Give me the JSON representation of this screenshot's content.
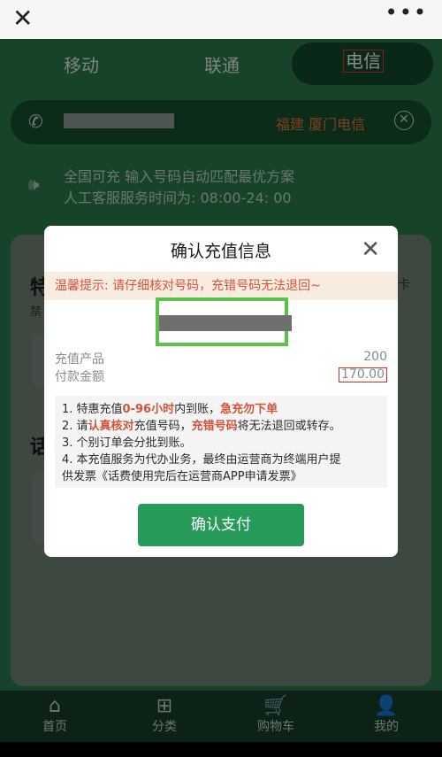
{
  "tabs": [
    {
      "label": "移动"
    },
    {
      "label": "联通"
    },
    {
      "label": "电信"
    }
  ],
  "phone_row": {
    "region": "福建 厦门电信"
  },
  "notice": {
    "line1": "全国可充 输入号码自动匹配最优方案",
    "line2": "人工客服服务时间为: 08:00-24: 00"
  },
  "background_card": {
    "title1": "特",
    "subtitle1": "禁",
    "title2": "话",
    "corner": "卡"
  },
  "modal": {
    "title": "确认充值信息",
    "warning": "温馨提示: 请仔细核对号码，充错号码无法退回~",
    "product_label": "充值产品",
    "product_value": "200",
    "amount_label": "付款金额",
    "amount_value": "170.00",
    "rules": {
      "r1a": "1. 特惠充值",
      "r1b": "0-96小时",
      "r1c": "内到账，",
      "r1d": "急充勿下单",
      "r2a": "2. 请",
      "r2b": "认真核对",
      "r2c": "充值号码，",
      "r2d": "充错号码",
      "r2e": "将无法退回或转存。",
      "r3": "3. 个别订单会分批到账。",
      "r4a": "4. 本充值服务为代办业务，最终由运营商为终端用户提",
      "r4b": "供发票《话费使用完后在运营商APP申请发票》"
    },
    "confirm_label": "确认支付"
  },
  "nav": [
    {
      "label": "首页",
      "icon": "home-icon"
    },
    {
      "label": "分类",
      "icon": "grid-icon"
    },
    {
      "label": "购物车",
      "icon": "cart-icon"
    },
    {
      "label": "我的",
      "icon": "user-icon"
    }
  ]
}
